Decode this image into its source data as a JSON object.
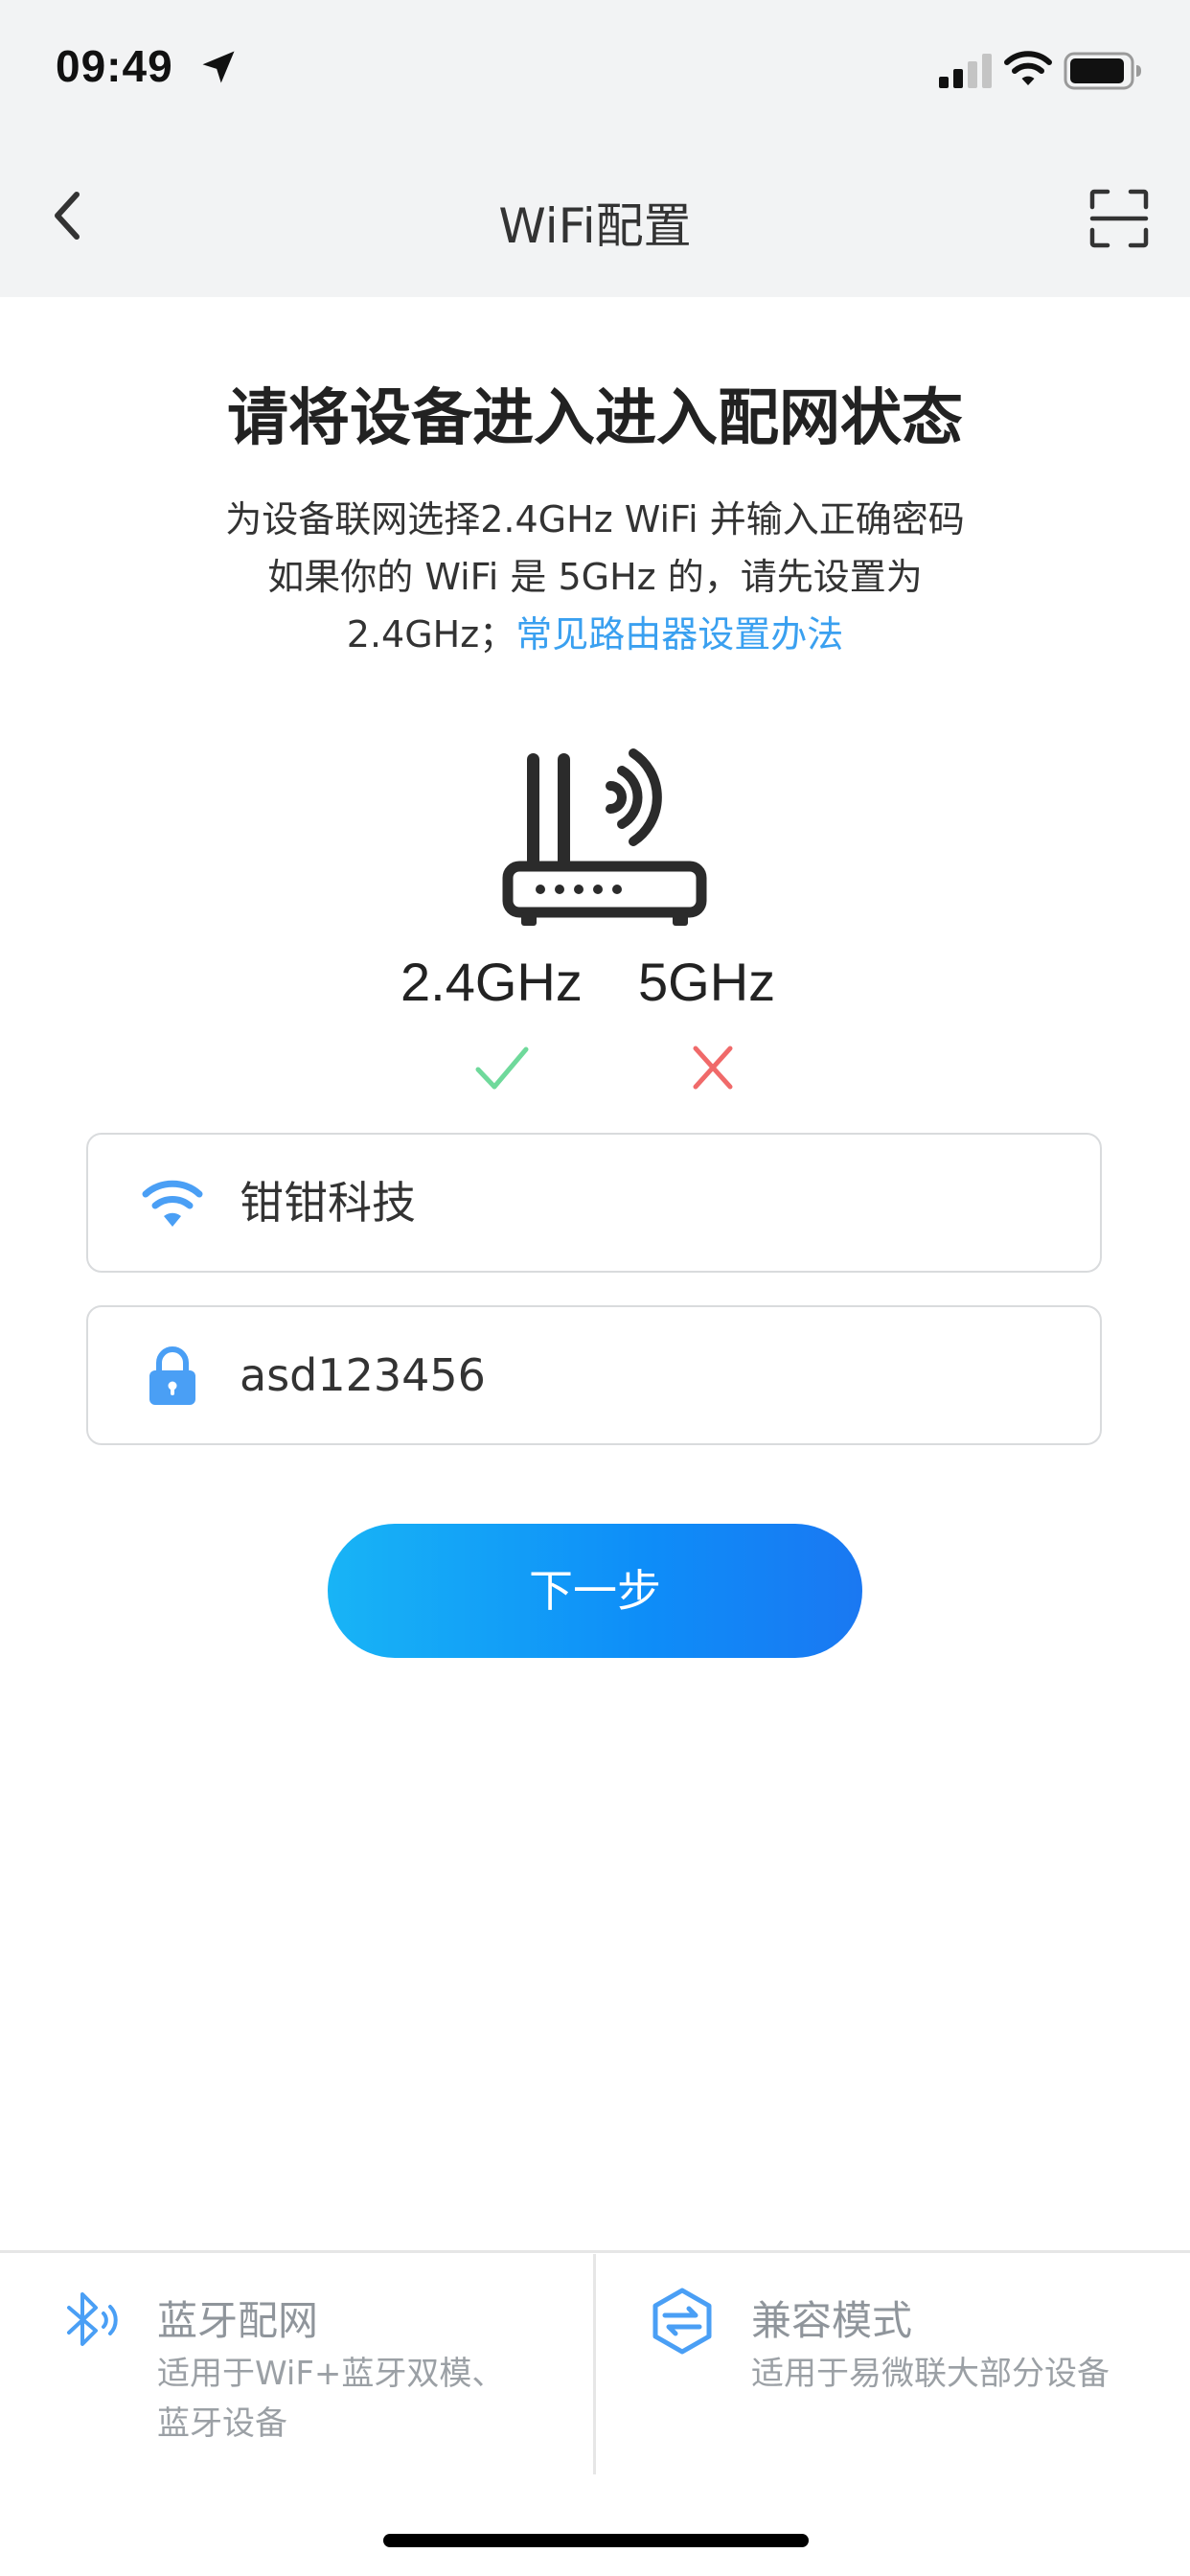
{
  "status_bar": {
    "time": "09:49"
  },
  "nav": {
    "title": "WiFi配置"
  },
  "heading": "请将设备进入进入配网状态",
  "description": {
    "line1": "为设备联网选择2.4GHz WiFi 并输入正确密码",
    "line2": "如果你的 WiFi 是 5GHz 的，请先设置为",
    "line3_prefix": "2.4GHz；",
    "link": "常见路由器设置办法"
  },
  "frequencies": {
    "supported": "2.4GHz",
    "unsupported": "5GHz"
  },
  "form": {
    "wifi_name": "钳钳科技",
    "password": "asd123456"
  },
  "next_button": "下一步",
  "modes": [
    {
      "title": "蓝牙配网",
      "sub1": "适用于WiF+蓝牙双模、",
      "sub2": "蓝牙设备"
    },
    {
      "title": "兼容模式",
      "sub1": "适用于易微联大部分设备"
    }
  ],
  "colors": {
    "accent": "#3aa0f0",
    "button_gradient_start": "#18b4f6",
    "button_gradient_end": "#1a78f2",
    "check": "#6fd99b",
    "cross": "#f06a6a",
    "muted_text": "#8f959b"
  },
  "icons": [
    "location-arrow-icon",
    "signal-icon",
    "wifi-icon",
    "battery-icon",
    "back-chevron-icon",
    "scan-icon",
    "router-icon",
    "check-icon",
    "cross-icon",
    "lock-icon",
    "bluetooth-icon",
    "compat-mode-icon"
  ]
}
